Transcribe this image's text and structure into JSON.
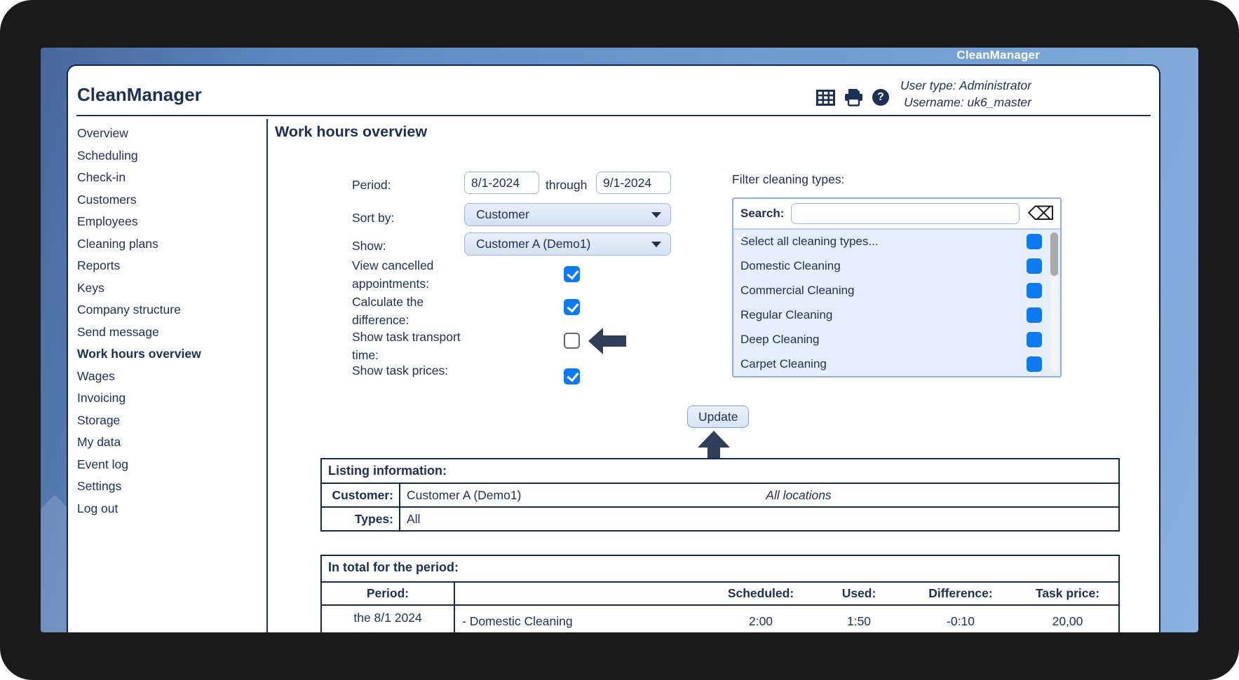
{
  "brand": {
    "overlay_title": "CleanManager"
  },
  "window": {
    "app_title": "CleanManager",
    "user_type": "User type: Administrator",
    "username": "Username: uk6_master"
  },
  "sidebar": {
    "items": [
      "Overview",
      "Scheduling",
      "Check-in",
      "Customers",
      "Employees",
      "Cleaning plans",
      "Reports",
      "Keys",
      "Company structure",
      "Send message",
      "Work hours overview",
      "Wages",
      "Invoicing",
      "Storage",
      "My data",
      "Event log",
      "Settings",
      "Log out"
    ],
    "active_item": "Work hours overview"
  },
  "main": {
    "title": "Work hours overview",
    "form": {
      "period_label": "Period:",
      "period_from": "8/1-2024",
      "through_label": "through",
      "period_to": "9/1-2024",
      "sort_by_label": "Sort by:",
      "sort_by_value": "Customer",
      "show_label": "Show:",
      "show_value": "Customer A (Demo1)",
      "options": [
        {
          "label": "View cancelled appointments:",
          "checked": true
        },
        {
          "label": "Calculate the difference:",
          "checked": true
        },
        {
          "label": "Show task transport time:",
          "checked": false
        },
        {
          "label": "Show task prices:",
          "checked": true
        }
      ],
      "update_button": "Update"
    },
    "filter": {
      "title": "Filter cleaning types:",
      "search_label": "Search:",
      "search_value": "",
      "items": [
        {
          "label": "Select all cleaning types...",
          "checked": true
        },
        {
          "label": "Domestic Cleaning",
          "checked": true
        },
        {
          "label": "Commercial Cleaning",
          "checked": true
        },
        {
          "label": "Regular Cleaning",
          "checked": true
        },
        {
          "label": "Deep Cleaning",
          "checked": true
        },
        {
          "label": "Carpet Cleaning",
          "checked": true
        }
      ]
    },
    "listing": {
      "title": "Listing information:",
      "rows": [
        {
          "label": "Customer:",
          "value": "Customer A (Demo1)",
          "note": "All locations"
        },
        {
          "label": "Types:",
          "value": "All",
          "note": ""
        }
      ]
    },
    "totals": {
      "title": "In total for the period:",
      "columns": {
        "period": "Period:",
        "scheduled": "Scheduled:",
        "used": "Used:",
        "difference": "Difference:",
        "task_price": "Task price:"
      },
      "rows": [
        {
          "period": "the 8/1 2024",
          "description": "- Domestic Cleaning",
          "scheduled": "2:00",
          "used": "1:50",
          "difference": "-0:10",
          "task_price": "20,00"
        }
      ]
    }
  },
  "colors": {
    "navy_text": "#1c2f55",
    "frame_black": "#1a1a1a",
    "blue_bg_start": "#5c86c0",
    "blue_bg_end": "#7ca7da",
    "checkbox_blue": "#0b7bf5",
    "panel_border": "#8fafdd",
    "annotation_arrow": "#2e4057"
  }
}
